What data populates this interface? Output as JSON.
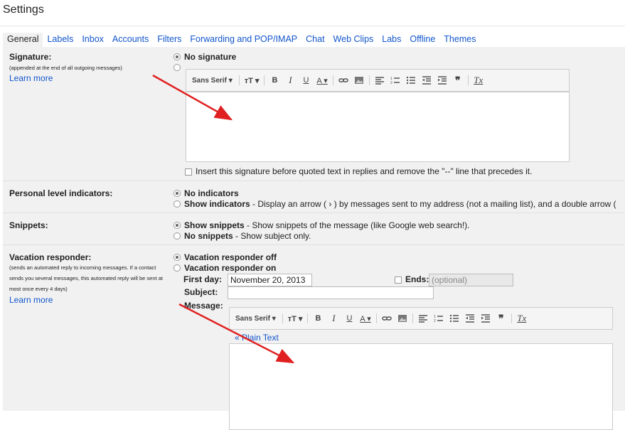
{
  "title": "Settings",
  "tabs": [
    "General",
    "Labels",
    "Inbox",
    "Accounts",
    "Filters",
    "Forwarding and POP/IMAP",
    "Chat",
    "Web Clips",
    "Labs",
    "Offline",
    "Themes"
  ],
  "signature": {
    "label": "Signature:",
    "note": "(appended at the end of all outgoing messages)",
    "learn_more": "Learn more",
    "option_none": "No signature",
    "font": "Sans Serif",
    "insert_checkbox": "Insert this signature before quoted text in replies and remove the \"--\" line that precedes it."
  },
  "personal": {
    "label": "Personal level indicators:",
    "option1": "No indicators",
    "option2_bold": "Show indicators",
    "option2_rest": " - Display an arrow ( › ) by messages sent to my address (not a mailing list), and a double arrow ("
  },
  "snippets": {
    "label": "Snippets:",
    "option1_bold": "Show snippets",
    "option1_rest": " - Show snippets of the message (like Google web search!).",
    "option2_bold": "No snippets",
    "option2_rest": " - Show subject only."
  },
  "vacation": {
    "label": "Vacation responder:",
    "note_lines": [
      "(sends an automated reply to incoming messages. If a contact",
      "sends you several messages, this automated reply will be sent at",
      "most once every 4 days)"
    ],
    "learn_more": "Learn more",
    "option_off": "Vacation responder off",
    "option_on": "Vacation responder on",
    "first_day_label": "First day:",
    "first_day_value": "November 20, 2013",
    "ends_label": "Ends:",
    "ends_placeholder": "(optional)",
    "subject_label": "Subject:",
    "message_label": "Message:",
    "font": "Sans Serif",
    "plain_text": "« Plain Text"
  },
  "colors": {
    "link": "#1155cc",
    "panel": "#f1f1f1",
    "arrow": "#e02020"
  }
}
